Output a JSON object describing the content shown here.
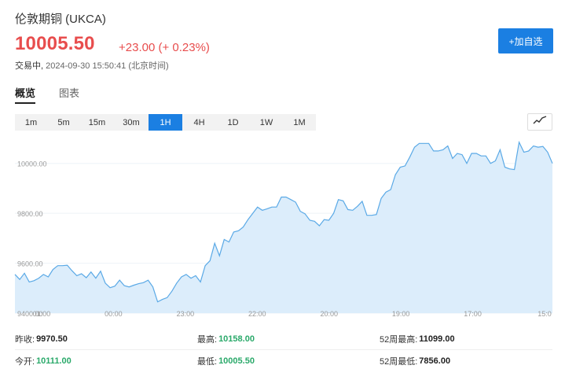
{
  "header": {
    "title": "伦敦期铜 (UKCA)",
    "price": "10005.50",
    "change": "+23.00 (+ 0.23%)",
    "status": "交易中,",
    "timestamp": "2024-09-30 15:50:41 (北京时间)",
    "add_watch_label": "+加自选"
  },
  "tabs": [
    {
      "label": "概览",
      "active": true
    },
    {
      "label": "图表",
      "active": false
    }
  ],
  "periods": [
    {
      "label": "1m",
      "active": false
    },
    {
      "label": "5m",
      "active": false
    },
    {
      "label": "15m",
      "active": false
    },
    {
      "label": "30m",
      "active": false
    },
    {
      "label": "1H",
      "active": true
    },
    {
      "label": "4H",
      "active": false
    },
    {
      "label": "1D",
      "active": false
    },
    {
      "label": "1W",
      "active": false
    },
    {
      "label": "1M",
      "active": false
    }
  ],
  "chart_type_icon": "line-chart-icon",
  "colors": {
    "up": "#e84d4d",
    "accent": "#1b7fe2",
    "line": "#5aa9e6",
    "area": "#dcedfb",
    "green_value": "#2aa96a"
  },
  "chart_data": {
    "type": "area",
    "y_ticks": [
      "10000.00",
      "9800.00",
      "9600.00",
      "9400.00"
    ],
    "x_ticks": [
      "01:00",
      "00:00",
      "23:00",
      "22:00",
      "20:00",
      "19:00",
      "17:00",
      "15:0"
    ],
    "ylim": [
      9400,
      10100
    ],
    "values": [
      9555,
      9535,
      9560,
      9525,
      9530,
      9540,
      9555,
      9545,
      9575,
      9590,
      9590,
      9592,
      9570,
      9550,
      9558,
      9542,
      9565,
      9540,
      9568,
      9520,
      9502,
      9508,
      9532,
      9510,
      9505,
      9512,
      9518,
      9522,
      9532,
      9505,
      9445,
      9455,
      9462,
      9488,
      9520,
      9545,
      9555,
      9540,
      9550,
      9525,
      9590,
      9610,
      9680,
      9630,
      9695,
      9685,
      9725,
      9730,
      9745,
      9775,
      9800,
      9825,
      9812,
      9818,
      9825,
      9825,
      9865,
      9865,
      9855,
      9845,
      9808,
      9798,
      9772,
      9768,
      9750,
      9775,
      9772,
      9800,
      9855,
      9850,
      9815,
      9812,
      9828,
      9848,
      9792,
      9792,
      9795,
      9860,
      9885,
      9895,
      9955,
      9985,
      9990,
      10025,
      10065,
      10080,
      10080,
      10080,
      10050,
      10050,
      10055,
      10070,
      10020,
      10040,
      10035,
      10000,
      10040,
      10040,
      10030,
      10030,
      10000,
      10010,
      10055,
      9985,
      9978,
      9975,
      10085,
      10045,
      10050,
      10070,
      10065,
      10068,
      10045,
      10000
    ],
    "grid": true
  },
  "stats": [
    [
      {
        "label": "昨收:",
        "value": "9970.50",
        "tone": "dark"
      },
      {
        "label": "最高:",
        "value": "10158.00",
        "tone": "green"
      },
      {
        "label": "52周最高:",
        "value": "11099.00",
        "tone": "dark"
      }
    ],
    [
      {
        "label": "今开:",
        "value": "10111.00",
        "tone": "green"
      },
      {
        "label": "最低:",
        "value": "10005.50",
        "tone": "green"
      },
      {
        "label": "52周最低:",
        "value": "7856.00",
        "tone": "dark"
      }
    ]
  ]
}
